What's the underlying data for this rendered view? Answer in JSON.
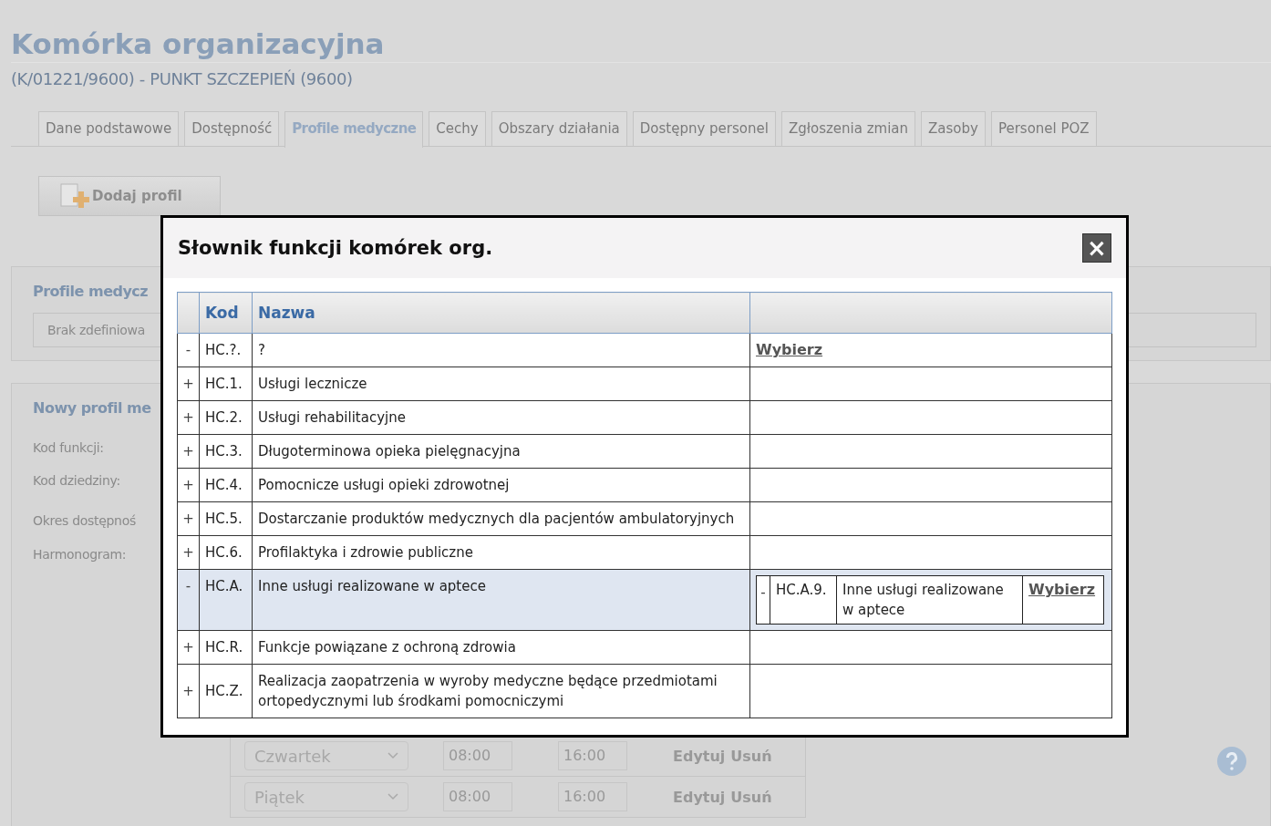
{
  "page": {
    "title": "Komórka organizacyjna",
    "subtitle": "(K/01221/9600) - PUNKT SZCZEPIEŃ (9600)"
  },
  "tabs": [
    {
      "label": "Dane podstawowe",
      "selected": false
    },
    {
      "label": "Dostępność",
      "selected": false
    },
    {
      "label": "Profile medyczne",
      "selected": true
    },
    {
      "label": "Cechy",
      "selected": false
    },
    {
      "label": "Obszary działania",
      "selected": false
    },
    {
      "label": "Dostępny personel",
      "selected": false
    },
    {
      "label": "Zgłoszenia zmian",
      "selected": false
    },
    {
      "label": "Zasoby",
      "selected": false
    },
    {
      "label": "Personel POZ",
      "selected": false
    }
  ],
  "add_button": {
    "label": "Dodaj profil",
    "disabled": true
  },
  "profiles_panel": {
    "heading": "Profile medycz",
    "empty_text": "Brak zdefiniowa"
  },
  "new_profile_panel": {
    "heading": "Nowy profil me",
    "labels": [
      "Kod funkcji:",
      "Kod dziedziny:",
      "Okres dostępnoś",
      "Harmonogram:"
    ],
    "schedule": [
      {
        "day": "Czwartek",
        "from": "08:00",
        "to": "16:00",
        "edit": "Edytuj",
        "remove": "Usuń"
      },
      {
        "day": "Piątek",
        "from": "08:00",
        "to": "16:00",
        "edit": "Edytuj",
        "remove": "Usuń"
      }
    ]
  },
  "dialog": {
    "title": "Słownik funkcji komórek org.",
    "close": "×",
    "columns": [
      "Kod",
      "Nazwa"
    ],
    "rows": [
      {
        "toggle": "-",
        "code": "HC.?.",
        "name": "?",
        "action": "Wybierz",
        "selected": false
      },
      {
        "toggle": "+",
        "code": "HC.1.",
        "name": "Usługi lecznicze",
        "selected": false
      },
      {
        "toggle": "+",
        "code": "HC.2.",
        "name": "Usługi rehabilitacyjne",
        "selected": false
      },
      {
        "toggle": "+",
        "code": "HC.3.",
        "name": "Długoterminowa opieka pielęgnacyjna",
        "selected": false
      },
      {
        "toggle": "+",
        "code": "HC.4.",
        "name": "Pomocnicze usługi opieki zdrowotnej",
        "selected": false
      },
      {
        "toggle": "+",
        "code": "HC.5.",
        "name": "Dostarczanie produktów medycznych dla pacjentów ambulatoryjnych",
        "selected": false
      },
      {
        "toggle": "+",
        "code": "HC.6.",
        "name": "Profilaktyka i zdrowie publiczne",
        "selected": false
      },
      {
        "toggle": "-",
        "code": "HC.A.",
        "name": "Inne usługi realizowane w aptece",
        "selected": true,
        "children": [
          {
            "toggle": "-",
            "code": "HC.A.9.",
            "name": "Inne usługi realizowane w aptece",
            "action": "Wybierz"
          }
        ]
      },
      {
        "toggle": "+",
        "code": "HC.R.",
        "name": "Funkcje powiązane z ochroną zdrowia",
        "selected": false
      },
      {
        "toggle": "+",
        "code": "HC.Z.",
        "name": "Realizacja zaopatrzenia w wyroby medyczne będące przedmiotami ortopedycznymi lub środkami pomocniczymi",
        "selected": false
      }
    ]
  }
}
